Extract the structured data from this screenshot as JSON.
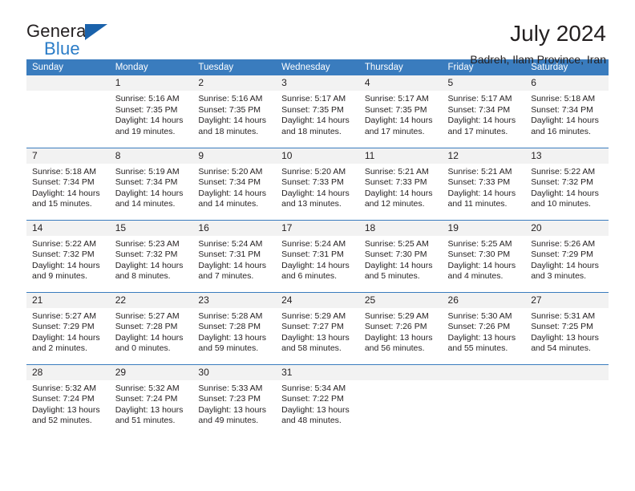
{
  "brand": {
    "name_top": "General",
    "name_bottom": "Blue",
    "triangle_color": "#1a62ab",
    "blue_color": "#2a7cc7"
  },
  "header": {
    "title": "July 2024",
    "subtitle": "Badreh, Ilam Province, Iran"
  },
  "calendar": {
    "accent_color": "#3a7cbe",
    "daynum_bg": "#f2f2f2",
    "weekday_headers": [
      "Sunday",
      "Monday",
      "Tuesday",
      "Wednesday",
      "Thursday",
      "Friday",
      "Saturday"
    ],
    "weeks": [
      [
        {
          "day": "",
          "lines": []
        },
        {
          "day": "1",
          "lines": [
            "Sunrise: 5:16 AM",
            "Sunset: 7:35 PM",
            "Daylight: 14 hours",
            "and 19 minutes."
          ]
        },
        {
          "day": "2",
          "lines": [
            "Sunrise: 5:16 AM",
            "Sunset: 7:35 PM",
            "Daylight: 14 hours",
            "and 18 minutes."
          ]
        },
        {
          "day": "3",
          "lines": [
            "Sunrise: 5:17 AM",
            "Sunset: 7:35 PM",
            "Daylight: 14 hours",
            "and 18 minutes."
          ]
        },
        {
          "day": "4",
          "lines": [
            "Sunrise: 5:17 AM",
            "Sunset: 7:35 PM",
            "Daylight: 14 hours",
            "and 17 minutes."
          ]
        },
        {
          "day": "5",
          "lines": [
            "Sunrise: 5:17 AM",
            "Sunset: 7:34 PM",
            "Daylight: 14 hours",
            "and 17 minutes."
          ]
        },
        {
          "day": "6",
          "lines": [
            "Sunrise: 5:18 AM",
            "Sunset: 7:34 PM",
            "Daylight: 14 hours",
            "and 16 minutes."
          ]
        }
      ],
      [
        {
          "day": "7",
          "lines": [
            "Sunrise: 5:18 AM",
            "Sunset: 7:34 PM",
            "Daylight: 14 hours",
            "and 15 minutes."
          ]
        },
        {
          "day": "8",
          "lines": [
            "Sunrise: 5:19 AM",
            "Sunset: 7:34 PM",
            "Daylight: 14 hours",
            "and 14 minutes."
          ]
        },
        {
          "day": "9",
          "lines": [
            "Sunrise: 5:20 AM",
            "Sunset: 7:34 PM",
            "Daylight: 14 hours",
            "and 14 minutes."
          ]
        },
        {
          "day": "10",
          "lines": [
            "Sunrise: 5:20 AM",
            "Sunset: 7:33 PM",
            "Daylight: 14 hours",
            "and 13 minutes."
          ]
        },
        {
          "day": "11",
          "lines": [
            "Sunrise: 5:21 AM",
            "Sunset: 7:33 PM",
            "Daylight: 14 hours",
            "and 12 minutes."
          ]
        },
        {
          "day": "12",
          "lines": [
            "Sunrise: 5:21 AM",
            "Sunset: 7:33 PM",
            "Daylight: 14 hours",
            "and 11 minutes."
          ]
        },
        {
          "day": "13",
          "lines": [
            "Sunrise: 5:22 AM",
            "Sunset: 7:32 PM",
            "Daylight: 14 hours",
            "and 10 minutes."
          ]
        }
      ],
      [
        {
          "day": "14",
          "lines": [
            "Sunrise: 5:22 AM",
            "Sunset: 7:32 PM",
            "Daylight: 14 hours",
            "and 9 minutes."
          ]
        },
        {
          "day": "15",
          "lines": [
            "Sunrise: 5:23 AM",
            "Sunset: 7:32 PM",
            "Daylight: 14 hours",
            "and 8 minutes."
          ]
        },
        {
          "day": "16",
          "lines": [
            "Sunrise: 5:24 AM",
            "Sunset: 7:31 PM",
            "Daylight: 14 hours",
            "and 7 minutes."
          ]
        },
        {
          "day": "17",
          "lines": [
            "Sunrise: 5:24 AM",
            "Sunset: 7:31 PM",
            "Daylight: 14 hours",
            "and 6 minutes."
          ]
        },
        {
          "day": "18",
          "lines": [
            "Sunrise: 5:25 AM",
            "Sunset: 7:30 PM",
            "Daylight: 14 hours",
            "and 5 minutes."
          ]
        },
        {
          "day": "19",
          "lines": [
            "Sunrise: 5:25 AM",
            "Sunset: 7:30 PM",
            "Daylight: 14 hours",
            "and 4 minutes."
          ]
        },
        {
          "day": "20",
          "lines": [
            "Sunrise: 5:26 AM",
            "Sunset: 7:29 PM",
            "Daylight: 14 hours",
            "and 3 minutes."
          ]
        }
      ],
      [
        {
          "day": "21",
          "lines": [
            "Sunrise: 5:27 AM",
            "Sunset: 7:29 PM",
            "Daylight: 14 hours",
            "and 2 minutes."
          ]
        },
        {
          "day": "22",
          "lines": [
            "Sunrise: 5:27 AM",
            "Sunset: 7:28 PM",
            "Daylight: 14 hours",
            "and 0 minutes."
          ]
        },
        {
          "day": "23",
          "lines": [
            "Sunrise: 5:28 AM",
            "Sunset: 7:28 PM",
            "Daylight: 13 hours",
            "and 59 minutes."
          ]
        },
        {
          "day": "24",
          "lines": [
            "Sunrise: 5:29 AM",
            "Sunset: 7:27 PM",
            "Daylight: 13 hours",
            "and 58 minutes."
          ]
        },
        {
          "day": "25",
          "lines": [
            "Sunrise: 5:29 AM",
            "Sunset: 7:26 PM",
            "Daylight: 13 hours",
            "and 56 minutes."
          ]
        },
        {
          "day": "26",
          "lines": [
            "Sunrise: 5:30 AM",
            "Sunset: 7:26 PM",
            "Daylight: 13 hours",
            "and 55 minutes."
          ]
        },
        {
          "day": "27",
          "lines": [
            "Sunrise: 5:31 AM",
            "Sunset: 7:25 PM",
            "Daylight: 13 hours",
            "and 54 minutes."
          ]
        }
      ],
      [
        {
          "day": "28",
          "lines": [
            "Sunrise: 5:32 AM",
            "Sunset: 7:24 PM",
            "Daylight: 13 hours",
            "and 52 minutes."
          ]
        },
        {
          "day": "29",
          "lines": [
            "Sunrise: 5:32 AM",
            "Sunset: 7:24 PM",
            "Daylight: 13 hours",
            "and 51 minutes."
          ]
        },
        {
          "day": "30",
          "lines": [
            "Sunrise: 5:33 AM",
            "Sunset: 7:23 PM",
            "Daylight: 13 hours",
            "and 49 minutes."
          ]
        },
        {
          "day": "31",
          "lines": [
            "Sunrise: 5:34 AM",
            "Sunset: 7:22 PM",
            "Daylight: 13 hours",
            "and 48 minutes."
          ]
        },
        {
          "day": "",
          "lines": []
        },
        {
          "day": "",
          "lines": []
        },
        {
          "day": "",
          "lines": []
        }
      ]
    ]
  }
}
